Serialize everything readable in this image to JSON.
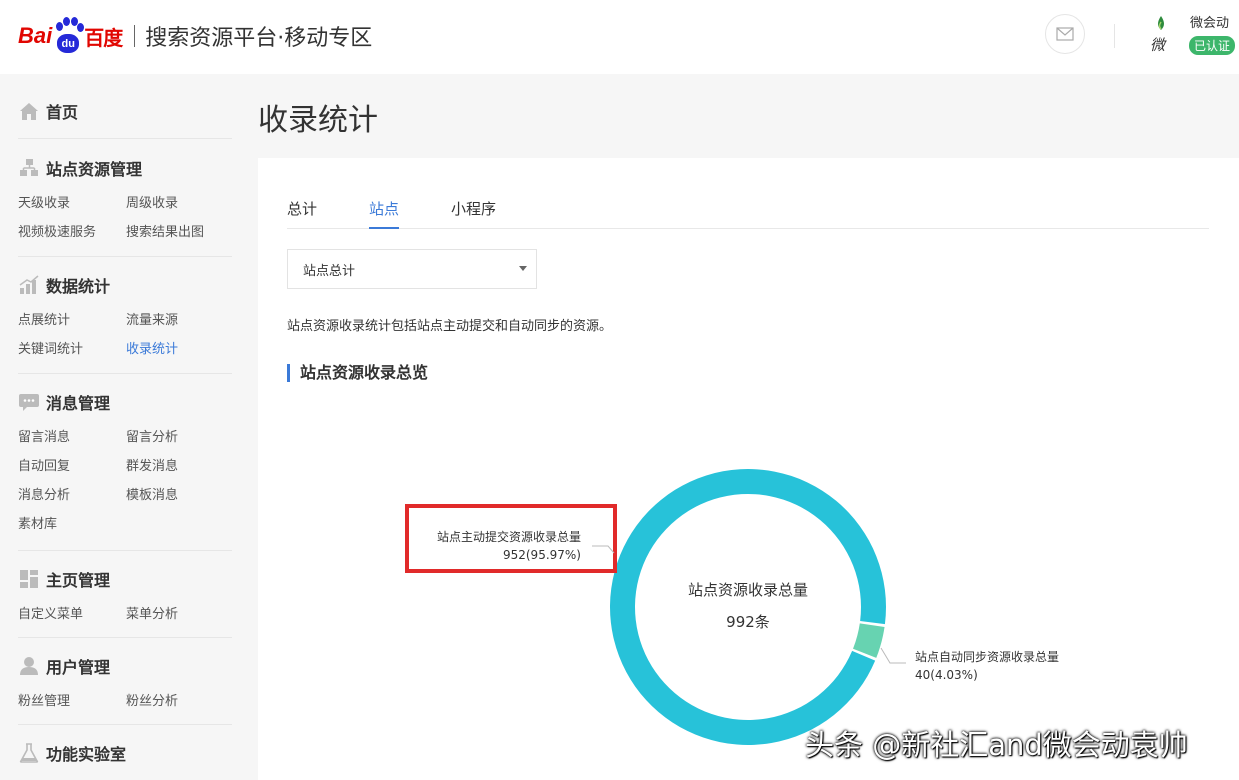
{
  "header": {
    "logo": {
      "bai": "Bai",
      "du": "du",
      "cn": "百度"
    },
    "title": "搜索资源平台·移动专区",
    "account": {
      "name": "微会动",
      "badge": "已认证"
    },
    "icons": {
      "mail": "mail-icon",
      "avatar": "avatar-logo"
    }
  },
  "sidebar": {
    "home": "首页",
    "groups": [
      {
        "title": "站点资源管理",
        "icon": "sitemap-icon",
        "links": [
          "天级收录",
          "周级收录",
          "视频极速服务",
          "搜索结果出图"
        ]
      },
      {
        "title": "数据统计",
        "icon": "bar-chart-icon",
        "links": [
          "点展统计",
          "流量来源",
          "关键词统计",
          "收录统计"
        ]
      },
      {
        "title": "消息管理",
        "icon": "chat-bubble-icon",
        "links": [
          "留言消息",
          "留言分析",
          "自动回复",
          "群发消息",
          "消息分析",
          "模板消息",
          "素材库"
        ]
      },
      {
        "title": "主页管理",
        "icon": "grid-icon",
        "links": [
          "自定义菜单",
          "菜单分析"
        ]
      },
      {
        "title": "用户管理",
        "icon": "user-icon",
        "links": [
          "粉丝管理",
          "粉丝分析"
        ]
      },
      {
        "title": "功能实验室",
        "icon": "flask-icon",
        "links": []
      }
    ],
    "active_link": "收录统计",
    "accent": "#3b7ad8"
  },
  "main": {
    "title": "收录统计",
    "tabs": [
      {
        "label": "总计",
        "active": false
      },
      {
        "label": "站点",
        "active": true
      },
      {
        "label": "小程序",
        "active": false
      }
    ],
    "select": {
      "value": "站点总计"
    },
    "description": "站点资源收录统计包括站点主动提交和自动同步的资源。",
    "section_title": "站点资源收录总览"
  },
  "chart_data": {
    "type": "pie",
    "center_label": "站点资源收录总量",
    "center_value": "992条",
    "slices": [
      {
        "name": "站点主动提交资源收录总量",
        "value": 952,
        "label": "952(95.97%)",
        "color": "#27c2d9"
      },
      {
        "name": "站点自动同步资源收录总量",
        "value": 40,
        "label": "40(4.03%)",
        "color": "#67d3b1"
      }
    ],
    "highlight_box_color": "#e12a2a"
  },
  "watermark": "头条 @新社汇and微会动袁帅"
}
